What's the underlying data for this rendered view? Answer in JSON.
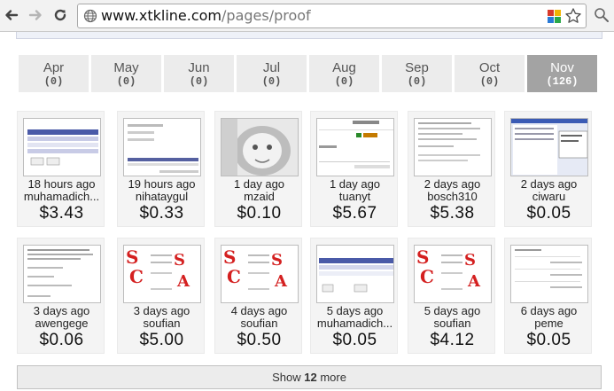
{
  "browser": {
    "url_host": "www.xtkline.com",
    "url_path": "/pages/proof"
  },
  "months": [
    {
      "name": "Apr",
      "count": "(0)",
      "active": false
    },
    {
      "name": "May",
      "count": "(0)",
      "active": false
    },
    {
      "name": "Jun",
      "count": "(0)",
      "active": false
    },
    {
      "name": "Jul",
      "count": "(0)",
      "active": false
    },
    {
      "name": "Aug",
      "count": "(0)",
      "active": false
    },
    {
      "name": "Sep",
      "count": "(0)",
      "active": false
    },
    {
      "name": "Oct",
      "count": "(0)",
      "active": false
    },
    {
      "name": "Nov",
      "count": "(126)",
      "active": true
    }
  ],
  "proofs": [
    {
      "time": "18 hours ago",
      "user": "muhamadich...",
      "amount": "$3.43",
      "thumb": "table"
    },
    {
      "time": "19 hours ago",
      "user": "nihataygul",
      "amount": "$0.33",
      "thumb": "form"
    },
    {
      "time": "1 day ago",
      "user": "mzaid",
      "amount": "$0.10",
      "thumb": "photo"
    },
    {
      "time": "1 day ago",
      "user": "tuanyt",
      "amount": "$5.67",
      "thumb": "amount"
    },
    {
      "time": "2 days ago",
      "user": "bosch310",
      "amount": "$5.38",
      "thumb": "text"
    },
    {
      "time": "2 days ago",
      "user": "ciwaru",
      "amount": "$0.05",
      "thumb": "window"
    },
    {
      "time": "3 days ago",
      "user": "awengege",
      "amount": "$0.06",
      "thumb": "doc"
    },
    {
      "time": "3 days ago",
      "user": "soufian",
      "amount": "$5.00",
      "thumb": "scam"
    },
    {
      "time": "4 days ago",
      "user": "soufian",
      "amount": "$0.50",
      "thumb": "scam"
    },
    {
      "time": "5 days ago",
      "user": "muhamadich...",
      "amount": "$0.05",
      "thumb": "table2"
    },
    {
      "time": "5 days ago",
      "user": "soufian",
      "amount": "$4.12",
      "thumb": "scam"
    },
    {
      "time": "6 days ago",
      "user": "peme",
      "amount": "$0.05",
      "thumb": "text2"
    }
  ],
  "show_more": {
    "prefix": "Show",
    "count": "12",
    "suffix": "more"
  },
  "colors": {
    "active_month": "#a3a3a3",
    "month_bg": "#ececec",
    "card_bg": "#f4f4f4",
    "scam_red": "#d42020"
  }
}
